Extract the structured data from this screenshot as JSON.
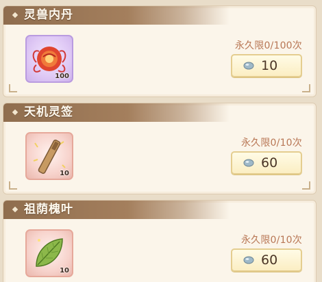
{
  "items": [
    {
      "title": "灵兽内丹",
      "quantity": "100",
      "limit_text": "永久限0/100次",
      "price": "10",
      "icon_name": "beast-core-icon",
      "currency_icon": "spirit-stone-icon"
    },
    {
      "title": "天机灵签",
      "quantity": "10",
      "limit_text": "永久限0/10次",
      "price": "60",
      "icon_name": "fortune-stick-icon",
      "currency_icon": "spirit-stone-icon"
    },
    {
      "title": "祖荫槐叶",
      "quantity": "10",
      "limit_text": "永久限0/10次",
      "price": "60",
      "icon_name": "locust-leaf-icon",
      "currency_icon": "spirit-stone-icon"
    }
  ],
  "colors": {
    "header_bar": "#9a7656",
    "limit_text": "#b87654",
    "price_button": "#fbeec3"
  }
}
